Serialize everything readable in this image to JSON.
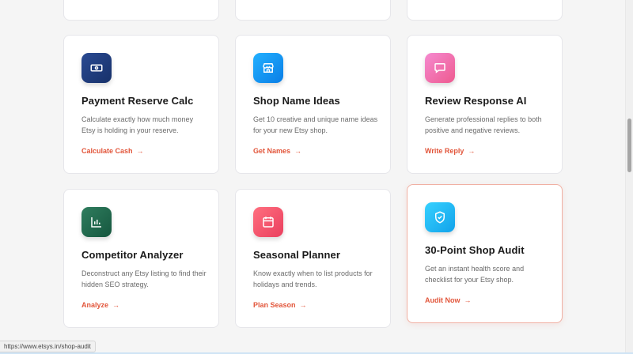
{
  "cards": [
    {
      "title": "Payment Reserve Calc",
      "description": "Calculate exactly how much money Etsy is holding in your reserve.",
      "cta": "Calculate Cash",
      "icon": "cash-icon",
      "color": "#1f3a78"
    },
    {
      "title": "Shop Name Ideas",
      "description": "Get 10 creative and unique name ideas for your new Etsy shop.",
      "cta": "Get Names",
      "icon": "storefront-icon",
      "color": "#1597f5"
    },
    {
      "title": "Review Response AI",
      "description": "Generate professional replies to both positive and negative reviews.",
      "cta": "Write Reply",
      "icon": "chat-bubble-icon",
      "color": "#f06bab"
    },
    {
      "title": "Competitor Analyzer",
      "description": "Deconstruct any Etsy listing to find their hidden SEO strategy.",
      "cta": "Analyze",
      "icon": "bar-chart-icon",
      "color": "#1f6b4f"
    },
    {
      "title": "Seasonal Planner",
      "description": "Know exactly when to list products for holidays and trends.",
      "cta": "Plan Season",
      "icon": "calendar-icon",
      "color": "#f0506a"
    },
    {
      "title": "30-Point Shop Audit",
      "description": "Get an instant health score and checklist for your Etsy shop.",
      "cta": "Audit Now",
      "icon": "shield-check-icon",
      "color": "#1fb6f0"
    }
  ],
  "cta_arrow": "→",
  "status_bar": {
    "url": "https://www.etsys.in/shop-audit"
  },
  "colors": {
    "accent": "#e2553a",
    "highlight_border": "#f0b0a3"
  }
}
